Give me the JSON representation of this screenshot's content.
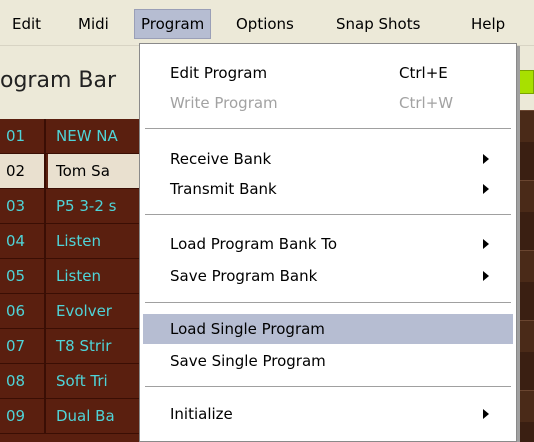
{
  "menubar": {
    "items": [
      {
        "label": "Edit"
      },
      {
        "label": "Midi"
      },
      {
        "label": "Program"
      },
      {
        "label": "Options"
      },
      {
        "label": "Snap Shots"
      },
      {
        "label": "Help"
      }
    ]
  },
  "bank_panel": {
    "title": "ogram Bar",
    "rows": [
      {
        "num": "01",
        "name": "NEW NA"
      },
      {
        "num": "02",
        "name": "Tom Sa"
      },
      {
        "num": "03",
        "name": "P5 3-2 s"
      },
      {
        "num": "04",
        "name": "Listen"
      },
      {
        "num": "05",
        "name": "Listen"
      },
      {
        "num": "06",
        "name": "Evolver"
      },
      {
        "num": "07",
        "name": "T8 Strir"
      },
      {
        "num": "08",
        "name": "Soft Tri"
      },
      {
        "num": "09",
        "name": "Dual Ba"
      }
    ]
  },
  "program_menu": {
    "items": [
      {
        "label": "Edit Program",
        "accel": "Ctrl+E"
      },
      {
        "label": "Write Program",
        "accel": "Ctrl+W"
      },
      {
        "label": "Receive Bank"
      },
      {
        "label": "Transmit Bank"
      },
      {
        "label": "Load Program Bank To"
      },
      {
        "label": "Save Program Bank"
      },
      {
        "label": "Load Single Program"
      },
      {
        "label": "Save Single Program"
      },
      {
        "label": "Initialize"
      }
    ]
  },
  "colors": {
    "menu_highlight": "#b6bdd2",
    "list_background": "#5a1f0f",
    "list_text": "#4fd4d8",
    "selected_row": "#e9e0cf",
    "green_indicator": "#a8e000"
  }
}
